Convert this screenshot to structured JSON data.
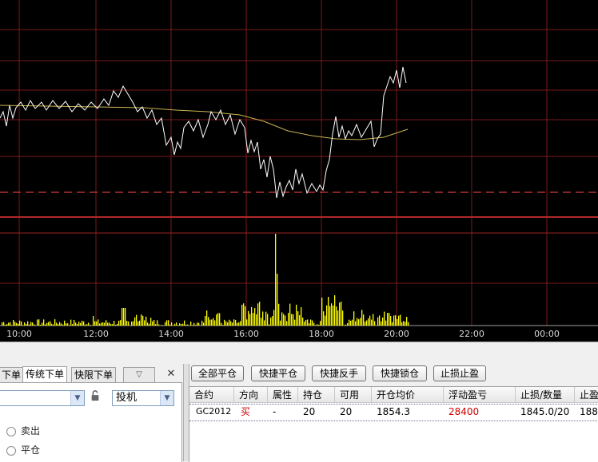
{
  "chart": {
    "time_labels": [
      "10:00",
      "12:00",
      "14:00",
      "16:00",
      "18:00",
      "20:00",
      "22:00",
      "00:00"
    ],
    "colors": {
      "background": "#000000",
      "grid": "#7a1a1a",
      "price_line": "#ffffff",
      "average_line": "#c8b450",
      "volume": "#ffff00",
      "reference_dashed": "#d43c3c"
    }
  },
  "order_panel": {
    "tabs": [
      "下单",
      "传统下单",
      "快限下单"
    ],
    "tab_scroll_symbol": "▽",
    "close_symbol": "✕",
    "hedge_select": "投机",
    "radios": [
      "卖出",
      "平仓"
    ]
  },
  "toolbar": {
    "buttons": [
      "全部平仓",
      "快捷平仓",
      "快捷反手",
      "快捷锁仓",
      "止损止盈"
    ]
  },
  "positions": {
    "headers": [
      "合约",
      "方向",
      "属性",
      "持仓",
      "可用",
      "开仓均价",
      "浮动盈亏",
      "止损/数量",
      "止盈"
    ],
    "row": {
      "contract": "GC2012",
      "direction": "买",
      "attribute": "-",
      "holding": "20",
      "available": "20",
      "open_avg_price": "1854.3",
      "floating_pnl": "28400",
      "stop_loss_qty": "1845.0/20",
      "take_profit": "188"
    },
    "colors": {
      "direction": "#d00000",
      "floating_pnl": "#d00000"
    }
  }
}
